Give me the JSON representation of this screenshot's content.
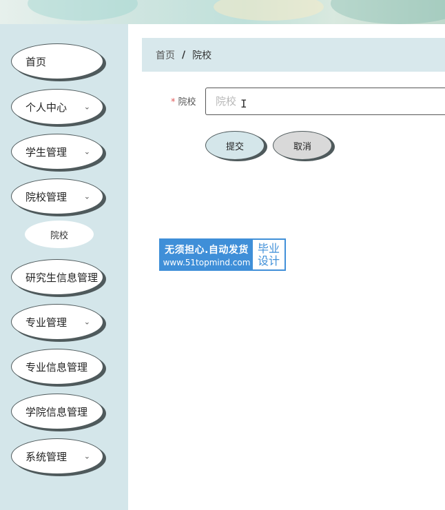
{
  "sidebar": {
    "items": [
      {
        "label": "首页",
        "has_chevron": false
      },
      {
        "label": "个人中心",
        "has_chevron": true
      },
      {
        "label": "学生管理",
        "has_chevron": true
      },
      {
        "label": "院校管理",
        "has_chevron": true
      },
      {
        "label": "研究生信息管理",
        "has_chevron": true
      },
      {
        "label": "专业管理",
        "has_chevron": true
      },
      {
        "label": "专业信息管理",
        "has_chevron": true
      },
      {
        "label": "学院信息管理",
        "has_chevron": true
      },
      {
        "label": "系统管理",
        "has_chevron": true
      }
    ],
    "subitem": {
      "label": "院校"
    }
  },
  "breadcrumb": {
    "home": "首页",
    "separator": "/",
    "current": "院校"
  },
  "form": {
    "field_label": "院校",
    "required_mark": "*",
    "input_value": "",
    "input_placeholder": "院校",
    "submit_label": "提交",
    "cancel_label": "取消"
  },
  "watermark": {
    "line1": "无须担心.自动发货",
    "line2": "www.51topmind.com",
    "right_top": "毕业",
    "right_bottom": "设计"
  },
  "colors": {
    "sidebar_bg": "#d4e6ea",
    "breadcrumb_bg": "#d8e8ec",
    "submit_bg": "#d4e6ea",
    "cancel_bg": "#d9d9d9",
    "required": "#e05a5a",
    "watermark_blue": "#3f8fd8"
  },
  "icons": {
    "chevron": "chevron-down-icon",
    "text_cursor": "text-cursor-icon"
  }
}
